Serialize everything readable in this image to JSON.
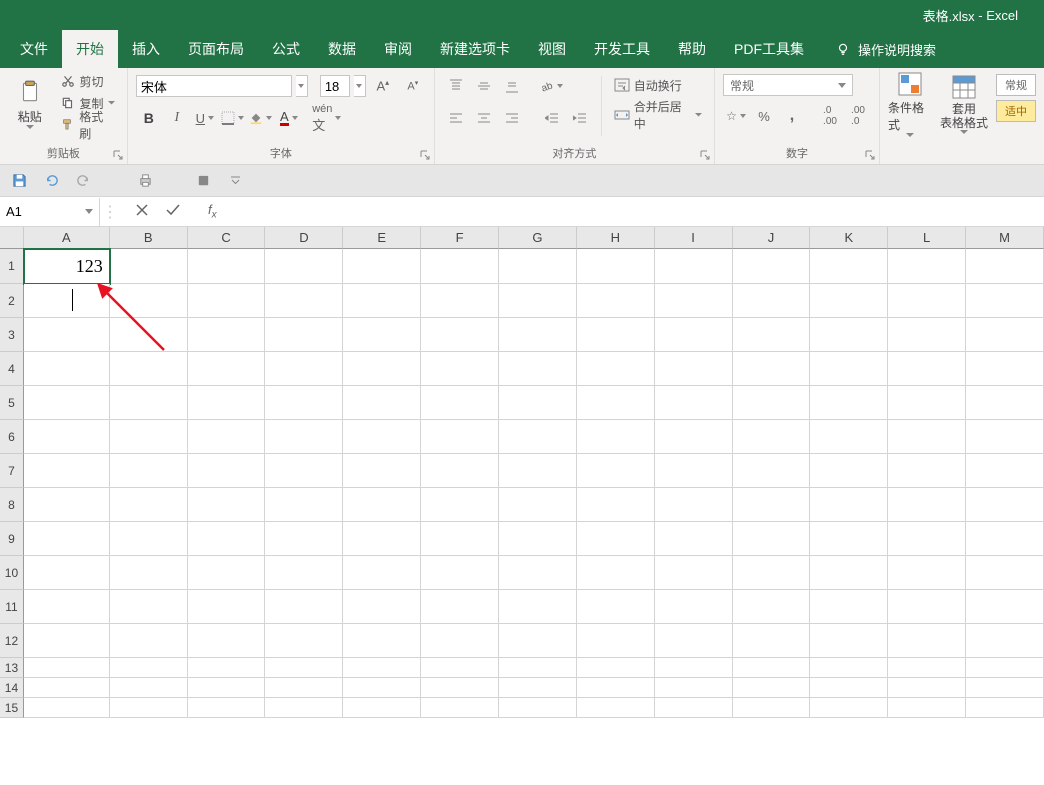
{
  "title_bar": {
    "doc": "表格.xlsx",
    "app": "Excel"
  },
  "tabs": {
    "file": "文件",
    "home": "开始",
    "insert": "插入",
    "layout": "页面布局",
    "formulas": "公式",
    "data": "数据",
    "review": "审阅",
    "newtab": "新建选项卡",
    "view": "视图",
    "dev": "开发工具",
    "help": "帮助",
    "pdf": "PDF工具集",
    "tellme": "操作说明搜索"
  },
  "clipboard": {
    "paste": "粘贴",
    "cut": "剪切",
    "copy": "复制",
    "painter": "格式刷",
    "group": "剪贴板"
  },
  "font": {
    "name": "宋体",
    "size": "18",
    "bold": "B",
    "italic": "I",
    "underline": "U",
    "group": "字体"
  },
  "alignment": {
    "wrap": "自动换行",
    "merge": "合并后居中",
    "group": "对齐方式"
  },
  "number": {
    "format": "常规",
    "percent": "%",
    "comma": ",",
    "group": "数字"
  },
  "styles": {
    "cond": "条件格式",
    "table": "套用\n表格格式",
    "cell": "常规\n适中"
  },
  "name_box": "A1",
  "cell_a1": "123",
  "columns": [
    "A",
    "B",
    "C",
    "D",
    "E",
    "F",
    "G",
    "H",
    "I",
    "J",
    "K",
    "L",
    "M"
  ],
  "rows_full": [
    1,
    2,
    3,
    4,
    5,
    6,
    7,
    8,
    9,
    10,
    11,
    12
  ],
  "rows_short": [
    13,
    14,
    15
  ]
}
